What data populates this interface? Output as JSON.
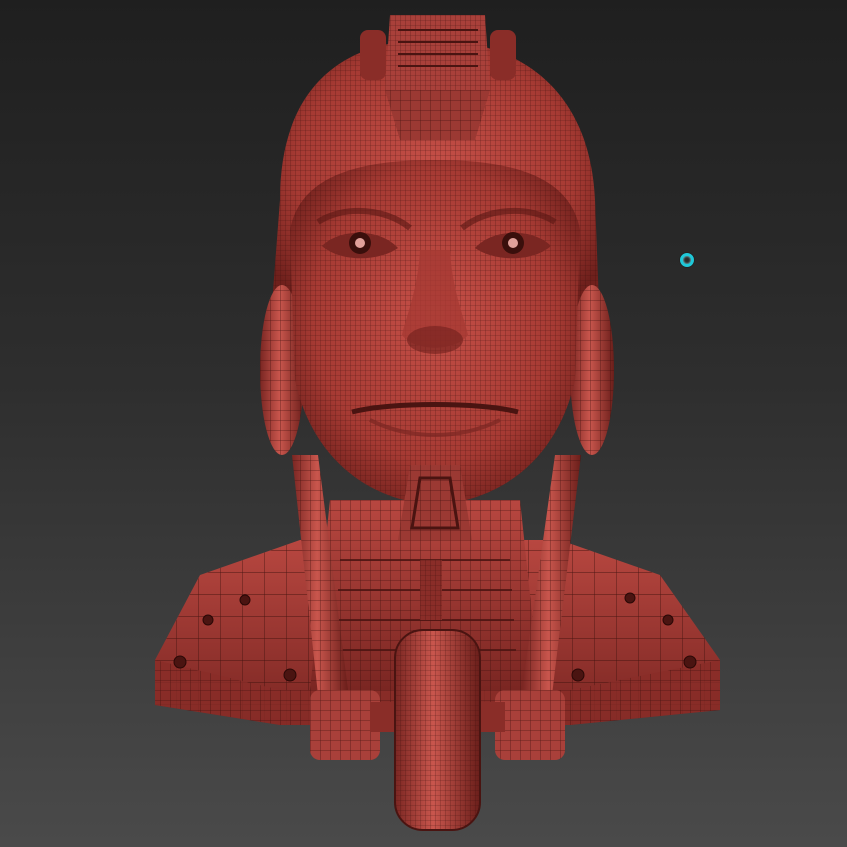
{
  "viewport": {
    "background_top": "#1f1f1f",
    "background_bottom": "#4a4a4a"
  },
  "model": {
    "name": "robot-head-bust",
    "display_mode": "polyframe-wireframe",
    "surface_color": "#b9463f",
    "surface_dark": "#6f201c",
    "wire_color": "#3a0f0c"
  },
  "cursor": {
    "icon": "brush-cursor-circle",
    "color": "#20c8d8"
  }
}
